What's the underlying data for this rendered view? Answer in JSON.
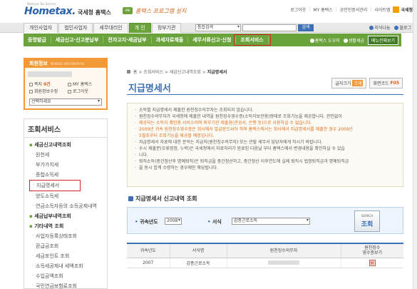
{
  "header": {
    "logo_text": "Hometax.",
    "logo_sub": "국세청 홈택스",
    "logo_tag": "National Tax Service",
    "slogan_badge": "ANI",
    "slogan": "홈택스 프로그램 설치",
    "util_links": [
      "로그아웃",
      "MY 홈택스",
      "공인인증서관리",
      "사이트맵"
    ],
    "org": "국세청"
  },
  "nav": {
    "tabs": [
      "개인사업자",
      "법인사업자",
      "세무대리인",
      "개 인",
      "정부기관"
    ],
    "active_tab": 3,
    "search_select": "통합검색",
    "search_button": "검색",
    "right_links": [
      "지식나눔",
      "블로그"
    ]
  },
  "subnav": {
    "items": [
      "증명발급",
      "세금신고·신고분납부",
      "전자고지·세금납부",
      "과세자료제출",
      "세무서류신고·신청",
      "조회서비스"
    ],
    "highlight_index": 5,
    "right_links": [
      "홈택스 도우미",
      "생활세금"
    ],
    "all_menu": "메뉴전체보기"
  },
  "member": {
    "title": "회원정보",
    "title_en": "MEMBER INFORMATION",
    "links": [
      {
        "label": "쪽지",
        "count": "0건"
      },
      {
        "label": "MY 홈택스",
        "count": ""
      },
      {
        "label": "회원정보수정",
        "count": ""
      },
      {
        "label": "로그아웃",
        "count": ""
      }
    ],
    "select_placeholder": "선택하세요"
  },
  "sidebar": {
    "title": "조회서비스",
    "entries": [
      {
        "type": "cat",
        "label": "세금신고내역조회"
      },
      {
        "type": "item",
        "label": "원천세"
      },
      {
        "type": "item",
        "label": "부가가치세"
      },
      {
        "type": "item",
        "label": "종합소득세"
      },
      {
        "type": "item",
        "label": "지급명세서",
        "selected": true
      },
      {
        "type": "item",
        "label": "양도소득세"
      },
      {
        "type": "item",
        "label": "연금소득자등의 소득공제내역"
      },
      {
        "type": "cat",
        "label": "세금납부내역조회"
      },
      {
        "type": "cat",
        "label": "기타내역 조회"
      },
      {
        "type": "item",
        "label": "사업자등록상태조회"
      },
      {
        "type": "item",
        "label": "환급금조회"
      },
      {
        "type": "item",
        "label": "세금포인트 조회"
      },
      {
        "type": "item",
        "label": "소득세공제내 세액조회"
      },
      {
        "type": "item",
        "label": "수입금액조회"
      },
      {
        "type": "item",
        "label": "국민연금보험료조회"
      }
    ]
  },
  "breadcrumb": {
    "items": [
      "홈",
      "조회서비스",
      "세금신고내역조회"
    ],
    "current": "지급명세서"
  },
  "page_title": "지급명세서",
  "tools": {
    "font_size_label": "글자크기",
    "font_size_value": "크게",
    "screen_code_label": "화면코드",
    "screen_code_value": "F05"
  },
  "notice": [
    {
      "text": "소득별 지급명세서 제출한 원천징수의무자는 조회되지 않습니다.",
      "orange": false
    },
    {
      "text": "원천징수의무자가 국세청에 제출한 내역을 원천징수영수증(소득자보관용)형태로 조회기능을 제공합니다. 관인없이",
      "orange": false
    },
    {
      "text": "제공되는 소득자 확인용 서비스이며 외부기관 제출용(관공서, 은행 등)으로 사용하실 수 없습니다.",
      "orange": true
    },
    {
      "text": "2009년 귀속 원천징수영수증은 회사에서 발급받으셔야 하며 홈택스에서는 회사에서 지급명세서를 제출한 경우 2009년",
      "orange": true
    },
    {
      "text": "5월초부터 조회기능을 제공할 예정입니다.",
      "orange": true
    },
    {
      "text": "지급명세서 자료에 대한 문의는 지급처(원천징수의무자) 또는 관할 세무서 담당자에게 하시기 바랍니다.",
      "orange": false
    },
    {
      "text": "수시 제출분(오류정정, 누락)은 국세청에서 자료처리가 완료된 다음날 부터 홈택스에서 변경내용을 확인하실 수 있습",
      "orange": false
    },
    {
      "text": "니다.",
      "orange": false
    },
    {
      "text": "퇴직소득(중간정산후 명예퇴직)은 퇴직금을 중간정산하고, 중간정산 이후연도에 실제 퇴직시 법정퇴직금과 명예퇴직금",
      "orange": false
    },
    {
      "text": "을 동시 합계 수령하는 경우에만 해당됩니다.",
      "orange": false
    }
  ],
  "section_title": "지급명세서 신고내역 조회",
  "filter": {
    "year_label": "귀속년도",
    "year_value": "2008",
    "form_label": "서식",
    "form_value": "갑종근로소득",
    "search_en": "SEARCH",
    "search_ko": "조회"
  },
  "table": {
    "headers": [
      "귀속년도",
      "서식명",
      "원천징수의무자",
      "원천징수\n영수증보기"
    ],
    "rows": [
      {
        "year": "2007",
        "form": "갑종근로소득"
      }
    ]
  }
}
